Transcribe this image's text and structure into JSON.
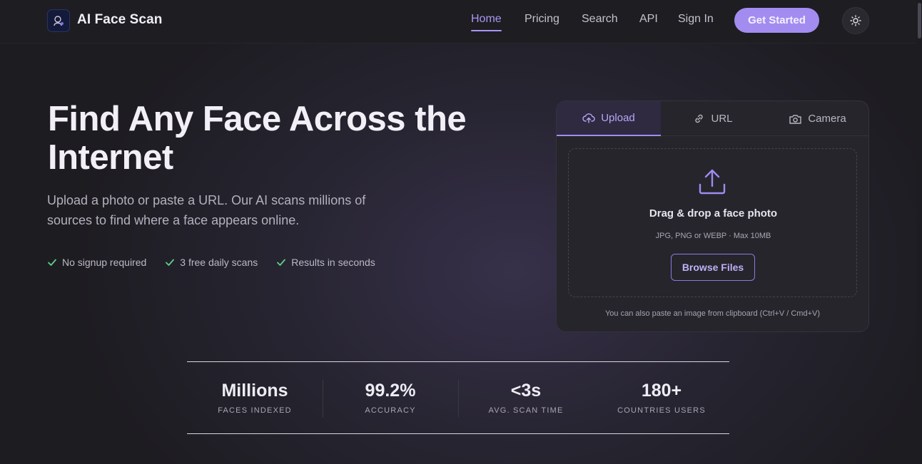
{
  "header": {
    "brand": "AI Face Scan",
    "nav": [
      {
        "label": "Home",
        "active": true
      },
      {
        "label": "Pricing"
      },
      {
        "label": "Search"
      },
      {
        "label": "API"
      },
      {
        "label": "Sign In"
      }
    ],
    "cta_label": "Get Started",
    "theme_icon": "sun-icon",
    "logo_icon": "face-scan-icon"
  },
  "hero": {
    "title": "Find Any Face Across the Internet",
    "subtitle": "Upload a photo or paste a URL. Our AI scans millions of sources to find where a face appears online.",
    "features": [
      "No signup required",
      "3 free daily scans",
      "Results in seconds"
    ]
  },
  "upload": {
    "tabs": [
      {
        "label": "Upload",
        "icon": "cloud-upload-icon",
        "active": true
      },
      {
        "label": "URL",
        "icon": "link-icon"
      },
      {
        "label": "Camera",
        "icon": "camera-icon"
      }
    ],
    "drop_title": "Drag & drop a face photo",
    "drop_hint": "JPG, PNG or WEBP · Max 10MB",
    "browse_label": "Browse Files",
    "paste_note": "You can also paste an image from clipboard (Ctrl+V / Cmd+V)"
  },
  "stats": [
    {
      "value": "Millions",
      "label": "FACES INDEXED"
    },
    {
      "value": "99.2%",
      "label": "ACCURACY"
    },
    {
      "value": "<3s",
      "label": "AVG. SCAN TIME"
    },
    {
      "value": "180+",
      "label": "COUNTRIES USERS"
    }
  ],
  "colors": {
    "accent": "#a38cf0",
    "background": "#1d1c21",
    "check": "#5fd08a"
  }
}
